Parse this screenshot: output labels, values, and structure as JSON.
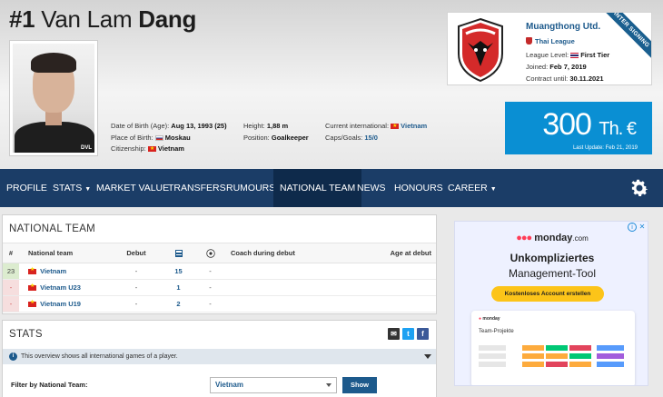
{
  "player": {
    "number": "#1",
    "first_name": "Van Lam",
    "last_name": "Dang",
    "photo_tag": "DVL"
  },
  "info": {
    "dob_label": "Date of Birth (Age):",
    "dob_value": "Aug 13, 1993 (25)",
    "pob_label": "Place of Birth:",
    "pob_value": "Moskau",
    "citizenship_label": "Citizenship:",
    "citizenship_value": "Vietnam",
    "height_label": "Height:",
    "height_value": "1,88 m",
    "position_label": "Position:",
    "position_value": "Goalkeeper",
    "current_intl_label": "Current international:",
    "current_intl_value": "Vietnam",
    "caps_label": "Caps/Goals:",
    "caps_value": "15/0"
  },
  "club": {
    "name": "Muangthong Utd.",
    "league": "Thai League",
    "level_label": "League Level:",
    "level_value": "First Tier",
    "joined_label": "Joined:",
    "joined_value": "Feb 7, 2019",
    "contract_label": "Contract until:",
    "contract_value": "30.11.2021",
    "ribbon": "WINTER SIGNING"
  },
  "market_value": {
    "amount": "300",
    "unit": "Th. €",
    "last_update": "Last Update: Feb 21, 2019"
  },
  "nav": {
    "items": [
      {
        "label": "PROFILE",
        "caret": false
      },
      {
        "label": "STATS",
        "caret": true
      },
      {
        "label": "MARKET VALUE",
        "caret": false
      },
      {
        "label": "TRANSFERS",
        "caret": false
      },
      {
        "label": "RUMOURS",
        "caret": false
      },
      {
        "label": "NATIONAL TEAM",
        "caret": false
      },
      {
        "label": "NEWS",
        "caret": false
      },
      {
        "label": "HONOURS",
        "caret": false
      },
      {
        "label": "CAREER",
        "caret": true
      }
    ],
    "active": "NATIONAL TEAM"
  },
  "national_team": {
    "title": "NATIONAL TEAM",
    "headers": {
      "idx": "#",
      "team": "National team",
      "debut": "Debut",
      "caps_icon": "shirt-icon",
      "goals_icon": "ball-icon",
      "coach": "Coach during debut",
      "age": "Age at debut"
    },
    "rows": [
      {
        "idx": "23",
        "team": "Vietnam",
        "debut": "-",
        "caps": "15",
        "goals": "-",
        "coach": "",
        "age": ""
      },
      {
        "idx": "-",
        "team": "Vietnam U23",
        "debut": "-",
        "caps": "1",
        "goals": "-",
        "coach": "",
        "age": ""
      },
      {
        "idx": "-",
        "team": "Vietnam U19",
        "debut": "-",
        "caps": "2",
        "goals": "-",
        "coach": "",
        "age": ""
      }
    ]
  },
  "stats": {
    "title": "STATS",
    "notice": "This overview shows all international games of a player.",
    "filter_label": "Filter by National Team:",
    "filter_value": "Vietnam",
    "show_button": "Show"
  },
  "ad": {
    "brand": "monday",
    "brand_suffix": ".com",
    "title": "Unkompliziertes",
    "subtitle": "Management-Tool",
    "button": "Kostenloses Account erstellen",
    "mock_brand": "monday",
    "mock_project": "Team-Projekte"
  },
  "colors": {
    "nav_bg": "#1b3d67",
    "nav_active": "#0e2a4b",
    "link": "#1d5a8c",
    "value_bg": "#0a8fd3",
    "ad_button": "#fcc419"
  }
}
